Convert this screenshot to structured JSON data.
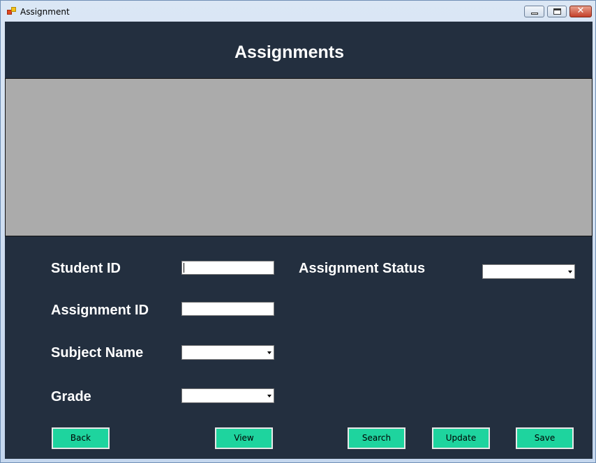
{
  "window": {
    "title": "Assignment",
    "controls": {
      "close_glyph": "✕"
    }
  },
  "header": {
    "title": "Assignments"
  },
  "form": {
    "student_id": {
      "label": "Student ID",
      "value": ""
    },
    "assignment_id": {
      "label": "Assignment ID",
      "value": ""
    },
    "subject_name": {
      "label": "Subject Name",
      "selected": ""
    },
    "grade": {
      "label": "Grade",
      "selected": ""
    },
    "assignment_status": {
      "label": "Assignment Status",
      "selected": ""
    }
  },
  "buttons": {
    "back": "Back",
    "view": "View",
    "search": "Search",
    "update": "Update",
    "save": "Save"
  },
  "colors": {
    "panel": "#232f3f",
    "grid": "#ababab",
    "button": "#1ed49e"
  }
}
